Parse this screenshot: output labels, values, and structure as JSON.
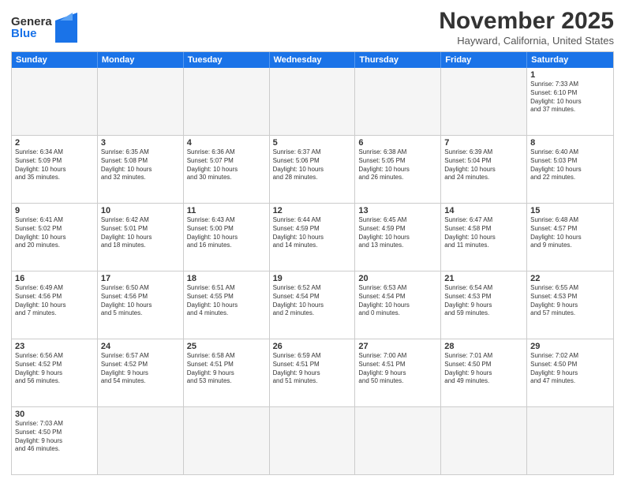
{
  "header": {
    "logo_general": "General",
    "logo_blue": "Blue",
    "month_title": "November 2025",
    "location": "Hayward, California, United States"
  },
  "days_of_week": [
    "Sunday",
    "Monday",
    "Tuesday",
    "Wednesday",
    "Thursday",
    "Friday",
    "Saturday"
  ],
  "weeks": [
    [
      {
        "day": "",
        "info": ""
      },
      {
        "day": "",
        "info": ""
      },
      {
        "day": "",
        "info": ""
      },
      {
        "day": "",
        "info": ""
      },
      {
        "day": "",
        "info": ""
      },
      {
        "day": "",
        "info": ""
      },
      {
        "day": "1",
        "info": "Sunrise: 7:33 AM\nSunset: 6:10 PM\nDaylight: 10 hours\nand 37 minutes."
      }
    ],
    [
      {
        "day": "2",
        "info": "Sunrise: 6:34 AM\nSunset: 5:09 PM\nDaylight: 10 hours\nand 35 minutes."
      },
      {
        "day": "3",
        "info": "Sunrise: 6:35 AM\nSunset: 5:08 PM\nDaylight: 10 hours\nand 32 minutes."
      },
      {
        "day": "4",
        "info": "Sunrise: 6:36 AM\nSunset: 5:07 PM\nDaylight: 10 hours\nand 30 minutes."
      },
      {
        "day": "5",
        "info": "Sunrise: 6:37 AM\nSunset: 5:06 PM\nDaylight: 10 hours\nand 28 minutes."
      },
      {
        "day": "6",
        "info": "Sunrise: 6:38 AM\nSunset: 5:05 PM\nDaylight: 10 hours\nand 26 minutes."
      },
      {
        "day": "7",
        "info": "Sunrise: 6:39 AM\nSunset: 5:04 PM\nDaylight: 10 hours\nand 24 minutes."
      },
      {
        "day": "8",
        "info": "Sunrise: 6:40 AM\nSunset: 5:03 PM\nDaylight: 10 hours\nand 22 minutes."
      }
    ],
    [
      {
        "day": "9",
        "info": "Sunrise: 6:41 AM\nSunset: 5:02 PM\nDaylight: 10 hours\nand 20 minutes."
      },
      {
        "day": "10",
        "info": "Sunrise: 6:42 AM\nSunset: 5:01 PM\nDaylight: 10 hours\nand 18 minutes."
      },
      {
        "day": "11",
        "info": "Sunrise: 6:43 AM\nSunset: 5:00 PM\nDaylight: 10 hours\nand 16 minutes."
      },
      {
        "day": "12",
        "info": "Sunrise: 6:44 AM\nSunset: 4:59 PM\nDaylight: 10 hours\nand 14 minutes."
      },
      {
        "day": "13",
        "info": "Sunrise: 6:45 AM\nSunset: 4:59 PM\nDaylight: 10 hours\nand 13 minutes."
      },
      {
        "day": "14",
        "info": "Sunrise: 6:47 AM\nSunset: 4:58 PM\nDaylight: 10 hours\nand 11 minutes."
      },
      {
        "day": "15",
        "info": "Sunrise: 6:48 AM\nSunset: 4:57 PM\nDaylight: 10 hours\nand 9 minutes."
      }
    ],
    [
      {
        "day": "16",
        "info": "Sunrise: 6:49 AM\nSunset: 4:56 PM\nDaylight: 10 hours\nand 7 minutes."
      },
      {
        "day": "17",
        "info": "Sunrise: 6:50 AM\nSunset: 4:56 PM\nDaylight: 10 hours\nand 5 minutes."
      },
      {
        "day": "18",
        "info": "Sunrise: 6:51 AM\nSunset: 4:55 PM\nDaylight: 10 hours\nand 4 minutes."
      },
      {
        "day": "19",
        "info": "Sunrise: 6:52 AM\nSunset: 4:54 PM\nDaylight: 10 hours\nand 2 minutes."
      },
      {
        "day": "20",
        "info": "Sunrise: 6:53 AM\nSunset: 4:54 PM\nDaylight: 10 hours\nand 0 minutes."
      },
      {
        "day": "21",
        "info": "Sunrise: 6:54 AM\nSunset: 4:53 PM\nDaylight: 9 hours\nand 59 minutes."
      },
      {
        "day": "22",
        "info": "Sunrise: 6:55 AM\nSunset: 4:53 PM\nDaylight: 9 hours\nand 57 minutes."
      }
    ],
    [
      {
        "day": "23",
        "info": "Sunrise: 6:56 AM\nSunset: 4:52 PM\nDaylight: 9 hours\nand 56 minutes."
      },
      {
        "day": "24",
        "info": "Sunrise: 6:57 AM\nSunset: 4:52 PM\nDaylight: 9 hours\nand 54 minutes."
      },
      {
        "day": "25",
        "info": "Sunrise: 6:58 AM\nSunset: 4:51 PM\nDaylight: 9 hours\nand 53 minutes."
      },
      {
        "day": "26",
        "info": "Sunrise: 6:59 AM\nSunset: 4:51 PM\nDaylight: 9 hours\nand 51 minutes."
      },
      {
        "day": "27",
        "info": "Sunrise: 7:00 AM\nSunset: 4:51 PM\nDaylight: 9 hours\nand 50 minutes."
      },
      {
        "day": "28",
        "info": "Sunrise: 7:01 AM\nSunset: 4:50 PM\nDaylight: 9 hours\nand 49 minutes."
      },
      {
        "day": "29",
        "info": "Sunrise: 7:02 AM\nSunset: 4:50 PM\nDaylight: 9 hours\nand 47 minutes."
      }
    ],
    [
      {
        "day": "30",
        "info": "Sunrise: 7:03 AM\nSunset: 4:50 PM\nDaylight: 9 hours\nand 46 minutes."
      },
      {
        "day": "",
        "info": ""
      },
      {
        "day": "",
        "info": ""
      },
      {
        "day": "",
        "info": ""
      },
      {
        "day": "",
        "info": ""
      },
      {
        "day": "",
        "info": ""
      },
      {
        "day": "",
        "info": ""
      }
    ]
  ]
}
